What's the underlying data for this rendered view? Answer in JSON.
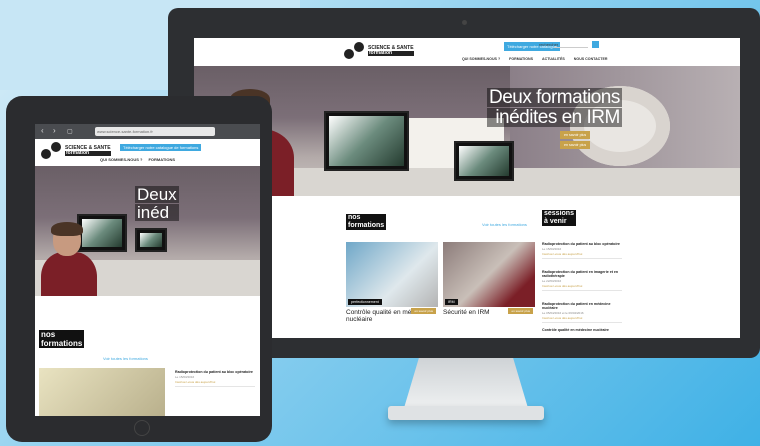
{
  "imac": {
    "header": {
      "logo_lines": [
        "SCIENCE & SANTE",
        "formation"
      ],
      "logo_tag": "formation",
      "cta": "Télécharger notre catalogue",
      "search_label": "rechercher",
      "search_placeholder": "rechercher",
      "menu": [
        "QUI SOMMES-NOUS ?",
        "FORMATIONS",
        "ACTUALITÉS",
        "NOUS CONTACTER"
      ]
    },
    "hero": {
      "title_line1": "Deux formations",
      "title_line2": "inédites en IRM",
      "btn1": "en savoir plus",
      "btn2": "en savoir plus"
    },
    "formations": {
      "title_line1": "nos",
      "title_line2": "formations",
      "all_link": "Voir toutes les formations",
      "cards": [
        {
          "tag": "perfectionnement",
          "more": "en savoir plus",
          "title": "Contrôle qualité en médecine nucléaire"
        },
        {
          "tag": "IRM",
          "more": "en savoir plus",
          "title": "Sécurité en IRM"
        }
      ]
    },
    "sessions": {
      "title_line1": "sessions",
      "title_line2": "à venir",
      "items": [
        {
          "title": "Radioprotection du patient au bloc opératoire",
          "date": "Le 15/03/2016",
          "link": "Inscrivez-vous dès aujourd'hui"
        },
        {
          "title": "Radioprotection du patient en imagerie et en radiothérapie",
          "date": "Le 22/03/2016",
          "link": "Inscrivez-vous dès aujourd'hui"
        },
        {
          "title": "Radioprotection du patient en médecine nucléaire",
          "date": "Le 05/04/2016 et le 06/04/2016",
          "link": "Inscrivez-vous dès aujourd'hui"
        },
        {
          "title": "Contrôle qualité en médecine nucléaire",
          "date": "",
          "link": ""
        }
      ]
    }
  },
  "tablet": {
    "url": "www.science-sante-formation.fr",
    "cta": "Télécharger notre catalogue de formations",
    "menu": [
      "QUI SOMMES-NOUS ?",
      "FORMATIONS"
    ],
    "hero_line1": "Deux",
    "hero_line2": "inéd",
    "formations_line1": "nos",
    "formations_line2": "formations",
    "all_link": "Voir toutes les formations",
    "session": {
      "title": "Radioprotection du patient au bloc opératoire",
      "date": "Le 15/03/2016",
      "link": "Inscrivez-vous dès aujourd'hui"
    }
  },
  "colors": {
    "accent_blue": "#3fa9e0",
    "gold": "#c8a24a",
    "device": "#2d2f32"
  }
}
